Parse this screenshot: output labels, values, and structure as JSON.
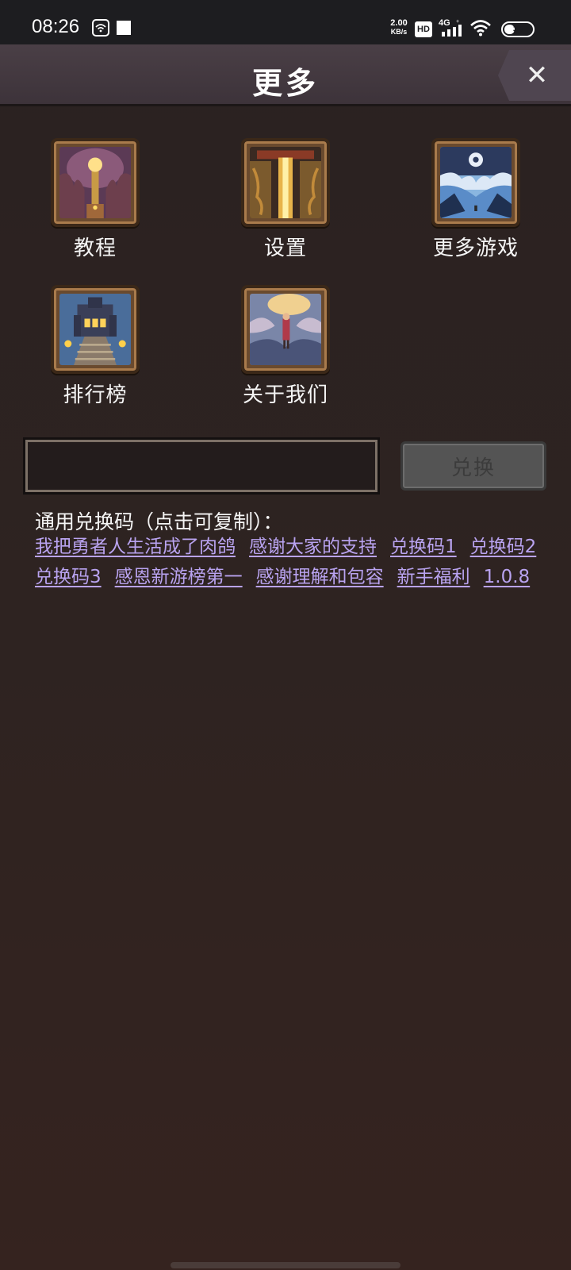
{
  "status_bar": {
    "time": "08:26",
    "net_speed_value": "2.00",
    "net_speed_unit": "KB/s",
    "hd_badge": "HD",
    "network": "4G",
    "battery": "35",
    "icons": [
      "wifi-hotspot-icon",
      "notification-square-icon",
      "hd-icon",
      "signal-icon",
      "wifi-icon",
      "battery-icon"
    ]
  },
  "header": {
    "title": "更多",
    "close_glyph": "✕"
  },
  "menu_tiles": [
    {
      "label": "教程",
      "icon": "tutorial-icon"
    },
    {
      "label": "设置",
      "icon": "settings-icon"
    },
    {
      "label": "更多游戏",
      "icon": "more-games-icon"
    },
    {
      "label": "排行榜",
      "icon": "leaderboard-icon"
    },
    {
      "label": "关于我们",
      "icon": "about-us-icon"
    }
  ],
  "redeem": {
    "input_value": "",
    "input_placeholder": "",
    "button_label": "兑换"
  },
  "codes_section": {
    "title": "通用兑换码（点击可复制）：",
    "codes": [
      "我把勇者人生活成了肉鸽",
      "感谢大家的支持",
      "兑换码1",
      "兑换码2",
      "兑换码3",
      "感恩新游榜第一",
      "感谢理解和包容",
      "新手福利",
      "1.0.8"
    ]
  },
  "colors": {
    "background": "#2b2322",
    "title_bar": "#453a41",
    "link": "#b9a3f0",
    "button_disabled": "#545454"
  }
}
